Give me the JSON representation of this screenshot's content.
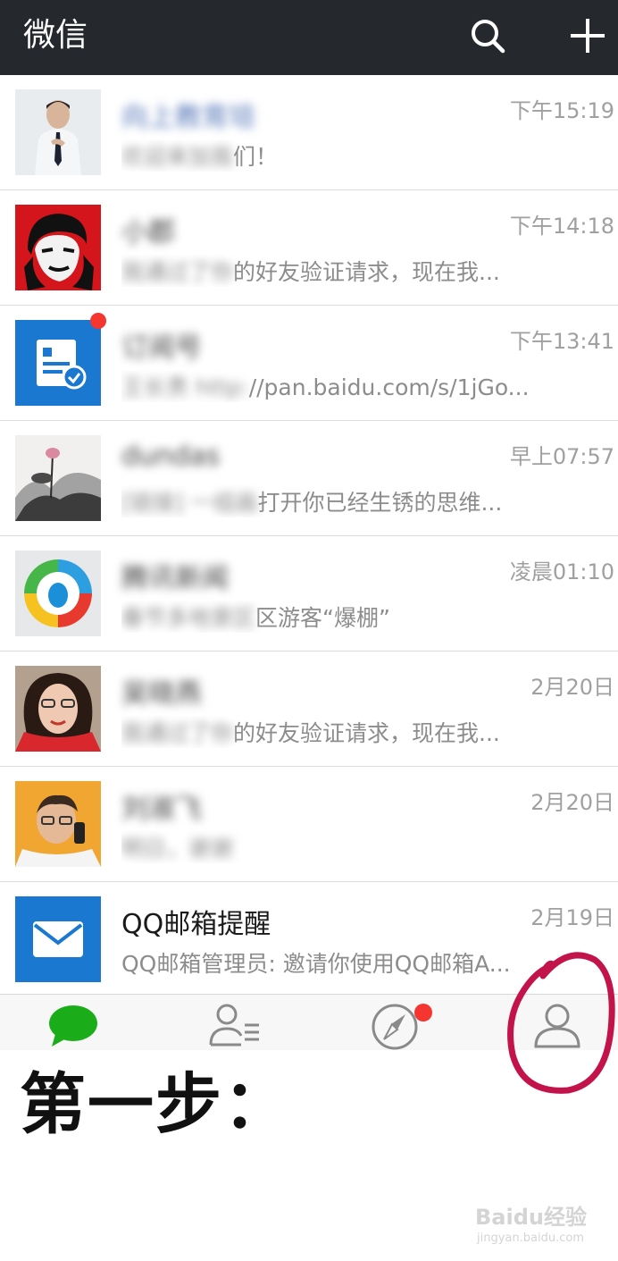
{
  "header": {
    "title": "微信"
  },
  "chats": [
    {
      "name": "向上教育培",
      "name_style": "blue-blurred",
      "time": "下午15:19",
      "preview_hidden": "欢迎来加我",
      "preview_visible": "们！",
      "avatar": "portrait-man-white-shirt",
      "badge": false
    },
    {
      "name": "小郡",
      "name_style": "blurred",
      "time": "下午14:18",
      "preview_hidden": "我通过了你",
      "preview_visible": "的好友验证请求，现在我...",
      "avatar": "che-red-portrait",
      "badge": false
    },
    {
      "name": "订阅号",
      "name_style": "blurred",
      "time": "下午13:41",
      "preview_hidden": "王长贵 http:",
      "preview_visible": "//pan.baidu.com/s/1jGo...",
      "avatar": "subscription-doc-icon",
      "badge": true
    },
    {
      "name": "dundas",
      "name_style": "blurred",
      "time": "早上07:57",
      "preview_hidden": "[链接] 一组画",
      "preview_visible": "打开你已经生锈的思维...",
      "avatar": "ink-lotus-painting",
      "badge": false
    },
    {
      "name": "腾讯新闻",
      "name_style": "blurred",
      "time": "凌晨01:10",
      "preview_hidden": "春节多地景区",
      "preview_visible": "区游客“爆棚”",
      "avatar": "tencent-news-logo",
      "badge": false
    },
    {
      "name": "吴晓燕",
      "name_style": "blurred",
      "time": "2月20日",
      "preview_hidden": "我通过了你",
      "preview_visible": "的好友验证请求，现在我...",
      "avatar": "portrait-woman-red",
      "badge": false
    },
    {
      "name": "刘淑飞",
      "name_style": "blurred",
      "time": "2月20日",
      "preview_hidden": "明日，谢谢",
      "preview_visible": "",
      "avatar": "portrait-man-phone",
      "badge": false
    },
    {
      "name": "QQ邮箱提醒",
      "name_style": "normal",
      "time": "2月19日",
      "preview_hidden": "",
      "preview_visible": "QQ邮箱管理员: 邀请你使用QQ邮箱A...",
      "avatar": "qq-mail-envelope-icon",
      "badge": false
    }
  ],
  "tabs": [
    {
      "icon": "chat-bubble-icon",
      "active": true
    },
    {
      "icon": "contacts-icon",
      "active": false
    },
    {
      "icon": "discover-compass-icon",
      "active": false,
      "badge": true
    },
    {
      "icon": "me-person-icon",
      "active": false
    }
  ],
  "annotation": {
    "step_text": "第一步："
  },
  "watermark": {
    "brand": "Baidu经验",
    "url": "jingyan.baidu.com"
  },
  "colors": {
    "header_bg": "#25292d",
    "accent_green": "#1aad19",
    "badge_red": "#f43530",
    "marker_red": "#c2134a",
    "tab_gray": "#8a8a8a"
  }
}
